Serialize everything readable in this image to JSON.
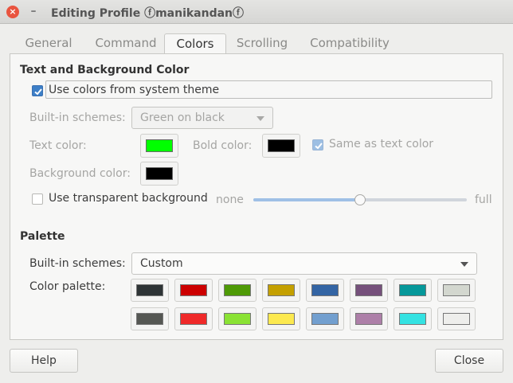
{
  "window": {
    "title": "Editing Profile ⓕmanikandanⓕ",
    "close_glyph": "×",
    "minimize_glyph": "–"
  },
  "tabs": [
    {
      "label": "General"
    },
    {
      "label": "Command"
    },
    {
      "label": "Colors",
      "active": true
    },
    {
      "label": "Scrolling"
    },
    {
      "label": "Compatibility"
    }
  ],
  "text_bg": {
    "section_title": "Text and Background Color",
    "use_system_theme_label": "Use colors from system theme",
    "use_system_theme_checked": true,
    "builtin_label": "Built-in schemes:",
    "builtin_value": "Green on black",
    "text_color_label": "Text color:",
    "text_color": "#00ff00",
    "bold_color_label": "Bold color:",
    "bold_color": "#000000",
    "same_as_text_label": "Same as text color",
    "same_as_text_checked": true,
    "bg_color_label": "Background color:",
    "bg_color": "#000000",
    "transparent_label": "Use transparent background",
    "transparent_checked": false,
    "slider_min_label": "none",
    "slider_max_label": "full",
    "transparency_level": 0.5
  },
  "palette": {
    "section_title": "Palette",
    "builtin_label": "Built-in schemes:",
    "builtin_value": "Custom",
    "palette_label": "Color palette:",
    "row1": [
      "#2e3436",
      "#cc0000",
      "#4e9a06",
      "#c4a000",
      "#3465a4",
      "#75507b",
      "#06989a",
      "#d3d7cf"
    ],
    "row2": [
      "#555753",
      "#ef2929",
      "#8ae234",
      "#fce94f",
      "#729fcf",
      "#ad7fa8",
      "#34e2e2",
      "#eeeeec"
    ]
  },
  "footer": {
    "help_label": "Help",
    "close_label": "Close"
  },
  "colors": {
    "accent": "#3d7fc7"
  }
}
